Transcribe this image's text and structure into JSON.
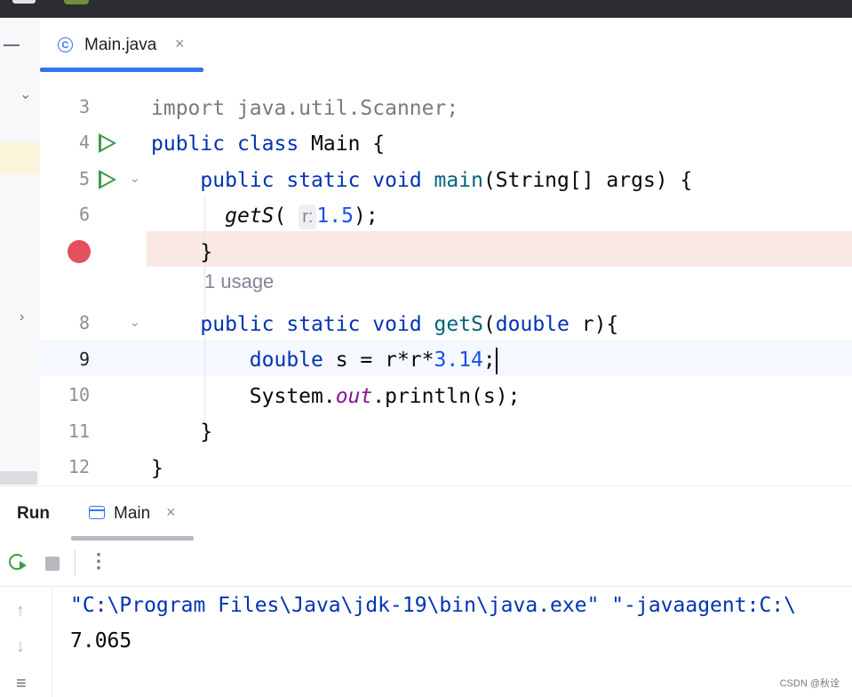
{
  "editor_tab": {
    "label": "Main.java",
    "close": "×",
    "icon": "class-c-icon"
  },
  "gutter": {
    "lines": [
      "3",
      "4",
      "5",
      "6",
      "",
      "",
      "8",
      "9",
      "10",
      "11",
      "12"
    ]
  },
  "code": {
    "line3": {
      "kw": "import",
      "rest": " java.util.Scanner;"
    },
    "line4": {
      "kw1": "public",
      "kw2": "class",
      "rest": " Main {"
    },
    "line5": {
      "indent": "    ",
      "kw1": "public",
      "kw2": "static",
      "kw3": "void",
      "fn": "main",
      "rest": "(String[] args) {"
    },
    "line6": {
      "indent": "      ",
      "fn": "getS",
      "open": "(",
      "hint": "r:",
      "num": "1.5",
      "close": ");"
    },
    "line7": {
      "text": "    }"
    },
    "usage": "1 usage",
    "line8": {
      "indent": "    ",
      "kw1": "public",
      "kw2": "static",
      "kw3": "void",
      "fn": "getS",
      "open": "(",
      "kw4": "double",
      "rest": " r){"
    },
    "line9": {
      "indent": "        ",
      "kw": "double",
      "mid": " s = r*r*",
      "num": "3.14",
      "end": ";"
    },
    "line10": {
      "indent": "        ",
      "pre": "System.",
      "field": "out",
      "post": ".println(s);"
    },
    "line11": {
      "text": "    }"
    },
    "line12": {
      "text": "}"
    }
  },
  "run_panel": {
    "title": "Run",
    "tab_label": "Main",
    "tab_close": "×",
    "more": "⋮"
  },
  "console": {
    "command": "\"C:\\Program Files\\Java\\jdk-19\\bin\\java.exe\" \"-javaagent:C:\\",
    "output": "7.065",
    "up_arrow": "↑",
    "down_arrow": "↓",
    "wrap": "≡"
  },
  "watermark": "CSDN @秋诠",
  "colors": {
    "keyword": "#0033b3",
    "function": "#00627a",
    "number": "#1750eb",
    "static_field": "#871094",
    "breakpoint": "#e5505f",
    "run_green": "#3e9b48",
    "accent": "#3574f0"
  }
}
